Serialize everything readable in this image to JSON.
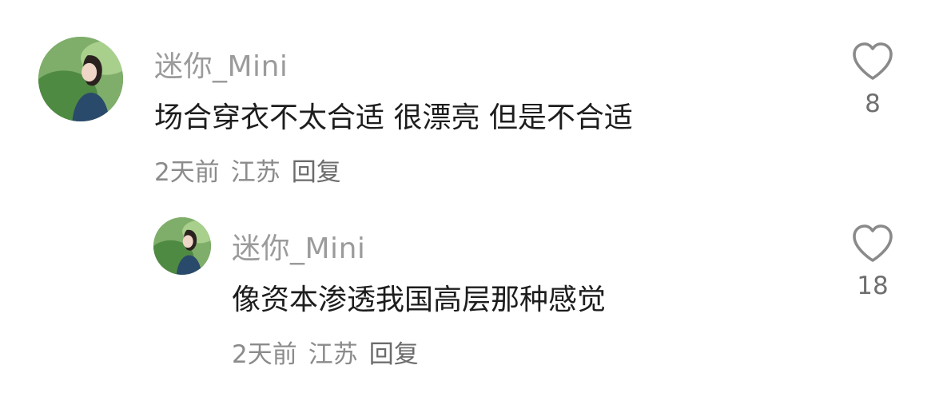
{
  "comments": [
    {
      "username": "迷你_Mini",
      "content": "场合穿衣不太合适 很漂亮 但是不合适",
      "time": "2天前",
      "location": "江苏",
      "reply_label": "回复",
      "like_count": "8"
    },
    {
      "username": "迷你_Mini",
      "content": "像资本渗透我国高层那种感觉",
      "time": "2天前",
      "location": "江苏",
      "reply_label": "回复",
      "like_count": "18"
    }
  ],
  "icons": {
    "like": "heart-outline-icon",
    "avatar": "user-avatar"
  },
  "colors": {
    "username": "#9b9b9b",
    "content": "#1d1d1d",
    "meta": "#8b8b8b",
    "like_stroke": "#8a8a8a"
  }
}
